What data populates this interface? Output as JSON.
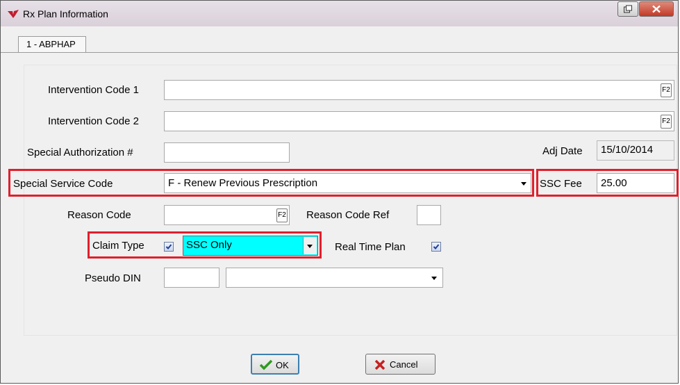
{
  "window": {
    "title": "Rx Plan Information",
    "tab": "1 - ABPHAP"
  },
  "form": {
    "intervention_code_1": {
      "label": "Intervention Code 1",
      "value": "",
      "key": "F2"
    },
    "intervention_code_2": {
      "label": "Intervention Code 2",
      "value": "",
      "key": "F2"
    },
    "special_authorization": {
      "label": "Special Authorization #",
      "value": ""
    },
    "adj_date": {
      "label": "Adj Date",
      "value": "15/10/2014"
    },
    "special_service_code": {
      "label": "Special Service Code",
      "value": "F - Renew Previous Prescription"
    },
    "ssc_fee": {
      "label": "SSC Fee",
      "value": "25.00"
    },
    "reason_code": {
      "label": "Reason Code",
      "value": "",
      "key": "F2"
    },
    "reason_code_ref": {
      "label": "Reason Code Ref",
      "value": ""
    },
    "claim_type": {
      "label": "Claim Type",
      "checked": true,
      "value": "SSC Only",
      "highlight_color": "#00ffff"
    },
    "real_time_plan": {
      "label": "Real Time Plan",
      "checked": true
    },
    "pseudo_din": {
      "label": "Pseudo DIN",
      "value": "",
      "select_value": ""
    }
  },
  "buttons": {
    "ok": "OK",
    "cancel": "Cancel"
  },
  "colors": {
    "highlight_box": "#e01f2c",
    "cyan_field": "#00ffff"
  }
}
